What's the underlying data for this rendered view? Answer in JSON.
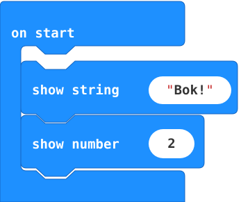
{
  "colors": {
    "block_blue": "#1E90FF",
    "block_outline": "#1565C0",
    "pill_bg": "#ffffff",
    "quote_red": "#c62828"
  },
  "event_block": {
    "label": "on start"
  },
  "statements": [
    {
      "label": "show string",
      "argument": "Bok!",
      "argument_type": "string",
      "open_quote": "\"",
      "close_quote": "\""
    },
    {
      "label": "show number",
      "argument": "2",
      "argument_type": "number"
    }
  ]
}
